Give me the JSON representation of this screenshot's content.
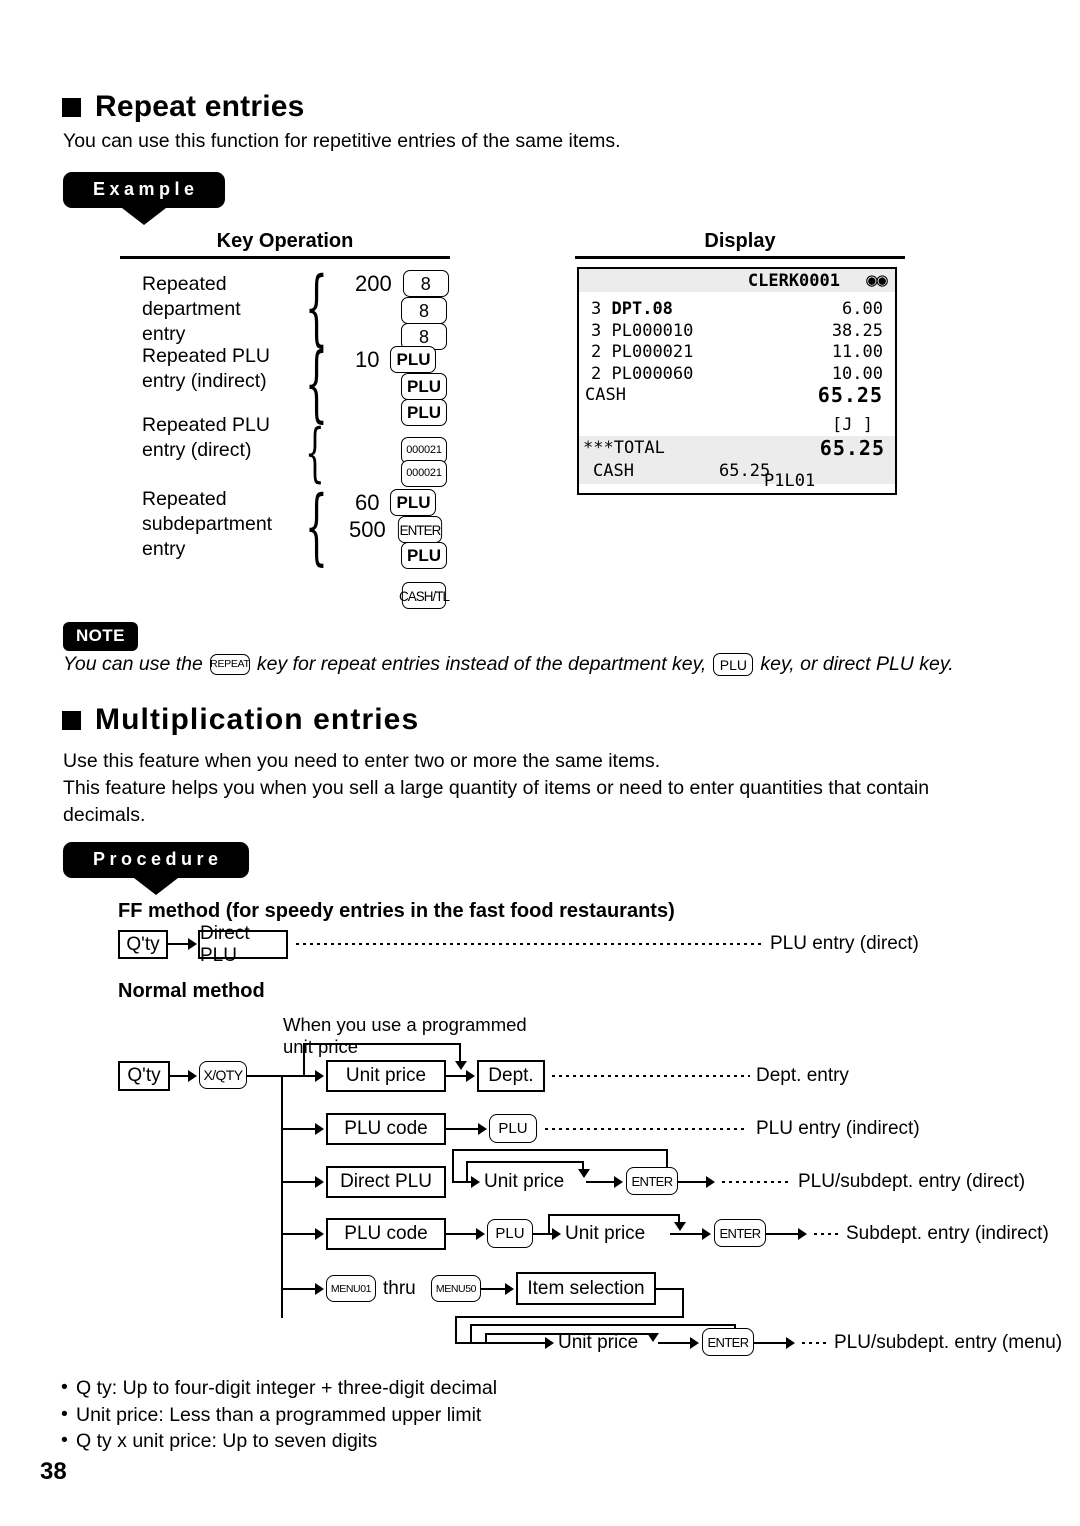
{
  "page_number": "38",
  "section1": {
    "heading": "Repeat entries",
    "intro": "You can use this function for repetitive entries of the same items.",
    "tag": "Example",
    "col_key": "Key Operation",
    "col_display": "Display",
    "operations": [
      {
        "label": "Repeated\ndepartment\nentry",
        "label_lines": [
          "Repeated",
          "department",
          "entry"
        ],
        "amount": "200",
        "keys": [
          {
            "text": "8",
            "style": "k-num"
          },
          {
            "text": "8",
            "style": "k-num"
          },
          {
            "text": "8",
            "style": "k-num"
          }
        ]
      },
      {
        "label_lines": [
          "Repeated PLU",
          "entry (indirect)"
        ],
        "amount": "10",
        "keys": [
          {
            "text": "PLU",
            "style": "k-wide"
          },
          {
            "text": "PLU",
            "style": "k-wide"
          },
          {
            "text": "PLU",
            "style": "k-wide"
          }
        ]
      },
      {
        "label_lines": [
          "Repeated PLU",
          "entry (direct)"
        ],
        "amount": "",
        "keys": [
          {
            "text": "000021",
            "style": "k-tiny"
          },
          {
            "text": "000021",
            "style": "k-tiny"
          }
        ]
      },
      {
        "label_lines": [
          "Repeated",
          "subdepartment",
          "entry"
        ],
        "amount": "60",
        "amount2": "500",
        "keys": [
          {
            "text": "PLU",
            "style": "k-wide"
          },
          {
            "text": "ENTER",
            "style": "k-sm"
          },
          {
            "text": "PLU",
            "style": "k-wide"
          }
        ]
      }
    ],
    "final_key": {
      "text": "CASH/TL",
      "style": "k-sm"
    }
  },
  "display": {
    "clerk": "CLERK0001",
    "status_icons": "◉◉",
    "lines": [
      {
        "qty": "3",
        "code": "DPT.08",
        "amount": "6.00"
      },
      {
        "qty": "3",
        "code": "PL000010",
        "amount": "38.25"
      },
      {
        "qty": "2",
        "code": "PL000021",
        "amount": "11.00"
      },
      {
        "qty": "2",
        "code": "PL000060",
        "amount": "10.00"
      }
    ],
    "cash_label": "CASH",
    "cash_amount": "65.25",
    "journal_marker": "[J  ]",
    "total_label": "***TOTAL",
    "total_amount": "65.25",
    "tender_label": "CASH",
    "tender_amount": "65.25",
    "footer": "P1L01"
  },
  "note": {
    "pill": "NOTE",
    "text_before": "You can use the",
    "key1": "REPEAT",
    "text_middle": "key for repeat entries instead of the department key,",
    "key2": "PLU",
    "text_after": "key, or direct PLU key."
  },
  "section2": {
    "heading": "Multiplication entries",
    "para1": "Use this feature when you need to enter two or more the same items.",
    "para2": "This feature helps you when you sell a large quantity of items or need to enter quantities that contain",
    "para3": "decimals.",
    "tag": "Procedure",
    "ff_title": "FF method (for speedy entries in the fast food restaurants)",
    "ff_qty": "Q'ty",
    "ff_direct_plu": "Direct PLU",
    "ff_result": "PLU entry (direct)",
    "normal_title": "Normal method",
    "note_programmed_l1": "When you use a programmed",
    "note_programmed_l2": "unit price",
    "qty": "Q'ty",
    "xqty_key": "X/QTY",
    "rows": [
      {
        "box1": "Unit price",
        "box2": "Dept.",
        "result": "Dept. entry"
      },
      {
        "box1": "PLU code",
        "box2": "PLU",
        "result": "PLU entry (indirect)"
      },
      {
        "box1": "Direct PLU",
        "box2": "Unit price",
        "box3": "ENTER",
        "result": "PLU/subdept. entry (direct)"
      },
      {
        "box1": "PLU code",
        "box2": "PLU",
        "box3": "Unit price",
        "box4": "ENTER",
        "result": "Subdept. entry (indirect)"
      },
      {
        "box1": "MENU01",
        "thru": "thru",
        "box2": "MENU50",
        "box3": "Item selection",
        "box4": "Unit price",
        "box5": "ENTER",
        "result": "PLU/subdept. entry (menu)"
      }
    ],
    "bullets": [
      "Q ty: Up to four-digit integer + three-digit decimal",
      "Unit price: Less than a programmed upper limit",
      "Q ty x unit price: Up to seven digits"
    ]
  }
}
